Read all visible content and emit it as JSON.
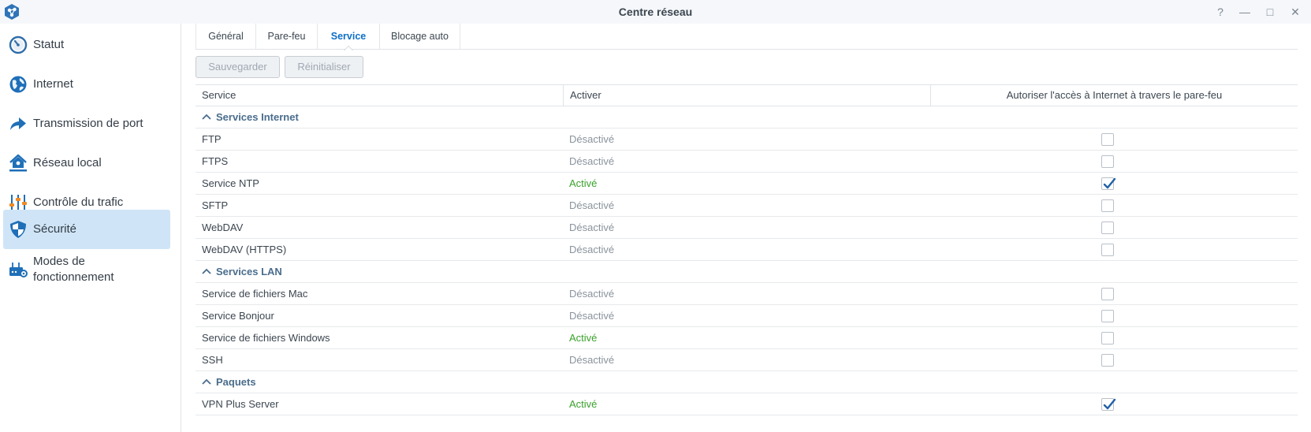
{
  "window": {
    "title": "Centre réseau",
    "help_glyph": "?",
    "minimize_glyph": "—",
    "maximize_glyph": "□",
    "close_glyph": "✕"
  },
  "sidebar": {
    "items": [
      {
        "label": "Statut",
        "icon": "gauge-icon"
      },
      {
        "label": "Internet",
        "icon": "globe-icon"
      },
      {
        "label": "Transmission de port",
        "icon": "forward-arrow-icon"
      },
      {
        "label": "Réseau local",
        "icon": "home-network-icon"
      },
      {
        "label": "Contrôle du trafic",
        "icon": "sliders-icon"
      },
      {
        "label": "Sécurité",
        "icon": "shield-icon",
        "active": true
      },
      {
        "label": "Modes de fonctionnement",
        "icon": "router-gear-icon"
      }
    ]
  },
  "tabs": [
    {
      "label": "Général"
    },
    {
      "label": "Pare-feu"
    },
    {
      "label": "Service",
      "active": true
    },
    {
      "label": "Blocage auto"
    }
  ],
  "toolbar": {
    "save_label": "Sauvegarder",
    "reset_label": "Réinitialiser"
  },
  "table": {
    "columns": [
      "Service",
      "Activer",
      "Autoriser l'accès à Internet à travers le pare-feu"
    ],
    "groups": [
      {
        "label": "Services Internet",
        "rows": [
          {
            "service": "FTP",
            "status": "Désactivé",
            "allowed": false
          },
          {
            "service": "FTPS",
            "status": "Désactivé",
            "allowed": false
          },
          {
            "service": "Service NTP",
            "status": "Activé",
            "allowed": true
          },
          {
            "service": "SFTP",
            "status": "Désactivé",
            "allowed": false
          },
          {
            "service": "WebDAV",
            "status": "Désactivé",
            "allowed": false
          },
          {
            "service": "WebDAV (HTTPS)",
            "status": "Désactivé",
            "allowed": false
          }
        ]
      },
      {
        "label": "Services LAN",
        "rows": [
          {
            "service": "Service de fichiers Mac",
            "status": "Désactivé",
            "allowed": false
          },
          {
            "service": "Service Bonjour",
            "status": "Désactivé",
            "allowed": false
          },
          {
            "service": "Service de fichiers Windows",
            "status": "Activé",
            "allowed": false
          },
          {
            "service": "SSH",
            "status": "Désactivé",
            "allowed": false
          }
        ]
      },
      {
        "label": "Paquets",
        "rows": [
          {
            "service": "VPN Plus Server",
            "status": "Activé",
            "allowed": true
          }
        ]
      }
    ]
  },
  "colors": {
    "accent": "#0f6fc6",
    "active_bg": "#cfe5f7",
    "enabled_text": "#3aa12b",
    "disabled_text": "#8a939c",
    "group_text": "#4a6d8c"
  }
}
